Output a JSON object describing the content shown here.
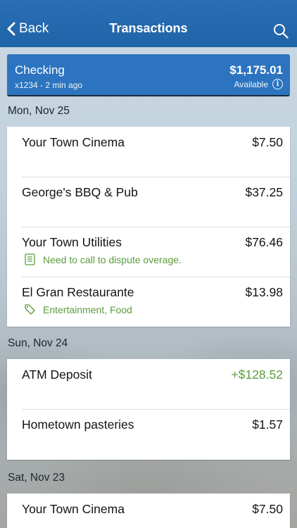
{
  "header": {
    "back_label": "Back",
    "title": "Transactions"
  },
  "account": {
    "name": "Checking",
    "subtitle": "x1234 - 2 min ago",
    "balance": "$1,175.01",
    "balance_label": "Available",
    "info_glyph": "i"
  },
  "groups": [
    {
      "date": "Mon, Nov 25",
      "transactions": [
        {
          "merchant": "Your Town Cinema",
          "amount": "$7.50"
        },
        {
          "merchant": "George's BBQ & Pub",
          "amount": "$37.25"
        },
        {
          "merchant": "Your Town Utilities",
          "amount": "$76.46",
          "note": "Need to call to dispute overage."
        },
        {
          "merchant": "El Gran Restaurante",
          "amount": "$13.98",
          "tags": "Entertainment, Food"
        }
      ]
    },
    {
      "date": "Sun, Nov 24",
      "transactions": [
        {
          "merchant": "ATM Deposit",
          "amount": "+$128.52"
        },
        {
          "merchant": "Hometown pasteries",
          "amount": "$1.57"
        }
      ]
    },
    {
      "date": "Sat, Nov 23",
      "transactions": [
        {
          "merchant": "Your Town Cinema",
          "amount": "$7.50"
        }
      ]
    }
  ],
  "colors": {
    "header": "#2a6fb6",
    "account_card": "#2c74bf",
    "credit_amount": "#5a9d3a",
    "note_text": "#5a9d3a"
  },
  "icons": {
    "back": "chevron-left-icon",
    "search": "search-icon",
    "info": "info-icon",
    "note": "note-icon",
    "tag": "tag-icon"
  }
}
